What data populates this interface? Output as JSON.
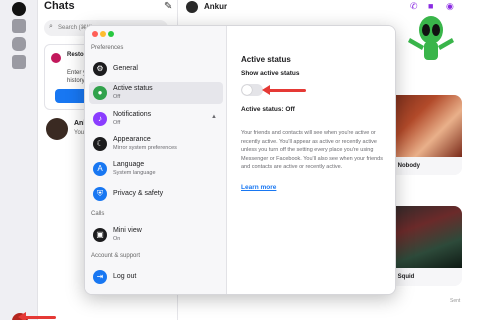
{
  "chats": {
    "title": "Chats",
    "search_placeholder": "Search (⌘K)",
    "restore": {
      "title": "Restore chat history",
      "desc": "Enter your PIN to restore your chat history"
    },
    "rows": [
      {
        "name": "Ank",
        "snippet": "You: …"
      }
    ]
  },
  "conversation": {
    "name": "Ankur",
    "cards": [
      "ent from Nobody",
      "ent from Squid"
    ],
    "sent": "Sent"
  },
  "settings": {
    "section_preferences": "Preferences",
    "section_calls": "Calls",
    "section_account": "Account & support",
    "items": [
      {
        "label": "General",
        "sub": ""
      },
      {
        "label": "Active status",
        "sub": "Off"
      },
      {
        "label": "Notifications",
        "sub": "Off"
      },
      {
        "label": "Appearance",
        "sub": "Mirror system preferences"
      },
      {
        "label": "Language",
        "sub": "System language"
      },
      {
        "label": "Privacy & safety",
        "sub": ""
      },
      {
        "label": "Mini view",
        "sub": "On"
      },
      {
        "label": "Log out",
        "sub": ""
      }
    ],
    "panel": {
      "title": "Active status",
      "show_label": "Show active status",
      "toggle_on": false,
      "status_text": "Active status: Off",
      "description": "Your friends and contacts will see when you're active or recently active. You'll appear as active or recently active unless you turn off the setting every place you're using Messenger or Facebook. You'll also see when your friends and contacts are active or recently active.",
      "learn_more": "Learn more"
    }
  },
  "colors": {
    "accent": "#1877f2",
    "annotation_arrow": "#e53935"
  }
}
